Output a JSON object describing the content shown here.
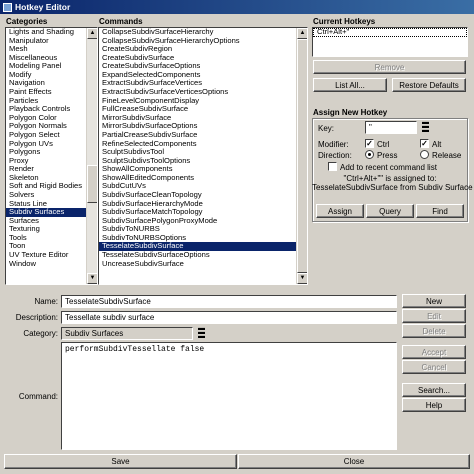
{
  "window": {
    "title": "Hotkey Editor"
  },
  "categories": {
    "header": "Categories",
    "items": [
      "Lights and Shading",
      "Manipulator",
      "Mesh",
      "Miscellaneous",
      "Modeling Panel",
      "Modify",
      "Navigation",
      "Paint Effects",
      "Particles",
      "Playback Controls",
      "Polygon Color",
      "Polygon Normals",
      "Polygon Select",
      "Polygon UVs",
      "Polygons",
      "Proxy",
      "Render",
      "Skeleton",
      "Soft and Rigid Bodies",
      "Solvers",
      "Status Line",
      "Subdiv Surfaces",
      "Surfaces",
      "Texturing",
      "Tools",
      "Toon",
      "UV Texture Editor",
      "Window"
    ],
    "selected_index": 21
  },
  "commands": {
    "header": "Commands",
    "items": [
      "CollapseSubdivSurfaceHierarchy",
      "CollapseSubdivSurfaceHierarchyOptions",
      "CreateSubdivRegion",
      "CreateSubdivSurface",
      "CreateSubdivSurfaceOptions",
      "ExpandSelectedComponents",
      "ExtractSubdivSurfaceVertices",
      "ExtractSubdivSurfaceVerticesOptions",
      "FineLevelComponentDisplay",
      "FullCreaseSubdivSurface",
      "MirrorSubdivSurface",
      "MirrorSubdivSurfaceOptions",
      "PartialCreaseSubdivSurface",
      "RefineSelectedComponents",
      "SculptSubdivsTool",
      "SculptSubdivsToolOptions",
      "ShowAllComponents",
      "ShowAllEditedComponents",
      "SubdCutUVs",
      "SubdivSurfaceCleanTopology",
      "SubdivSurfaceHierarchyMode",
      "SubdivSurfaceMatchTopology",
      "SubdivSurfacePolygonProxyMode",
      "SubdivToNURBS",
      "SubdivToNURBSOptions",
      "TesselateSubdivSurface",
      "TesselateSubdivSurfaceOptions",
      "UncreaseSubdivSurface"
    ],
    "selected_index": 25
  },
  "current_hotkeys": {
    "header": "Current Hotkeys",
    "items": [
      "Ctrl+Alt+\""
    ],
    "remove_label": "Remove",
    "list_all_label": "List All...",
    "restore_defaults_label": "Restore Defaults"
  },
  "assign": {
    "header": "Assign New Hotkey",
    "key_label": "Key:",
    "key_value": "\"",
    "modifier_label": "Modifier:",
    "ctrl_label": "Ctrl",
    "ctrl_checked": true,
    "alt_label": "Alt",
    "alt_checked": true,
    "direction_label": "Direction:",
    "press_label": "Press",
    "release_label": "Release",
    "direction_value": "Press",
    "recent_label": "Add to recent command list",
    "recent_checked": false,
    "status_line1": "\"Ctrl+Alt+\"\" is assigned to:",
    "status_line2": "TesselateSubdivSurface from Subdiv Surface",
    "assign_label": "Assign",
    "query_label": "Query",
    "find_label": "Find",
    "check_mark": "✓"
  },
  "editor": {
    "name_label": "Name:",
    "name_value": "TesselateSubdivSurface",
    "description_label": "Description:",
    "description_value": "Tessellate subdiv surface",
    "category_label": "Category:",
    "category_value": "Subdiv Surfaces",
    "command_label": "Command:",
    "command_value": "performSubdivTessellate  false",
    "new_label": "New",
    "edit_label": "Edit",
    "delete_label": "Delete",
    "accept_label": "Accept",
    "cancel_label": "Cancel",
    "search_label": "Search...",
    "help_label": "Help"
  },
  "footer": {
    "save_label": "Save",
    "close_label": "Close"
  }
}
